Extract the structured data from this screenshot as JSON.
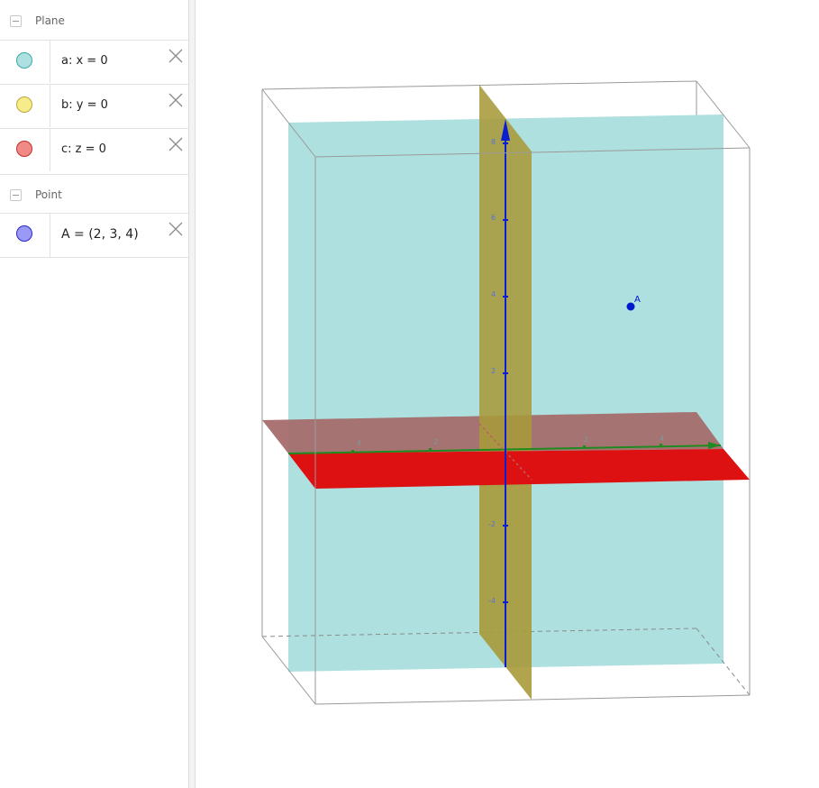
{
  "algebra": {
    "groups": [
      {
        "title": "Plane",
        "items": [
          {
            "label": "a: x = 0",
            "color": "#aee0e0",
            "border": "#4aa"
          },
          {
            "label": "b: y = 0",
            "color": "#f7ec8a",
            "border": "#b9a63a"
          },
          {
            "label": "c: z = 0",
            "color": "#f08a86",
            "border": "#c0302b"
          }
        ]
      },
      {
        "title": "Point",
        "items": [
          {
            "label": "A = (2, 3, 4)",
            "color": "#9a9af5",
            "border": "#2626c8"
          }
        ]
      }
    ]
  },
  "graphics3d": {
    "point_label": "A",
    "z_ticks": [
      "8",
      "6",
      "4",
      "2",
      "-2",
      "-4"
    ],
    "x_ticks": [
      "4",
      "2",
      "2",
      "4"
    ],
    "colors": {
      "plane_x": "#aee0e0",
      "plane_y": "#a99a3a",
      "plane_z": "#dd1111",
      "point": "#0018cc",
      "z_axis": "#0b1fd0",
      "y_axis": "#1f8a1f"
    }
  }
}
